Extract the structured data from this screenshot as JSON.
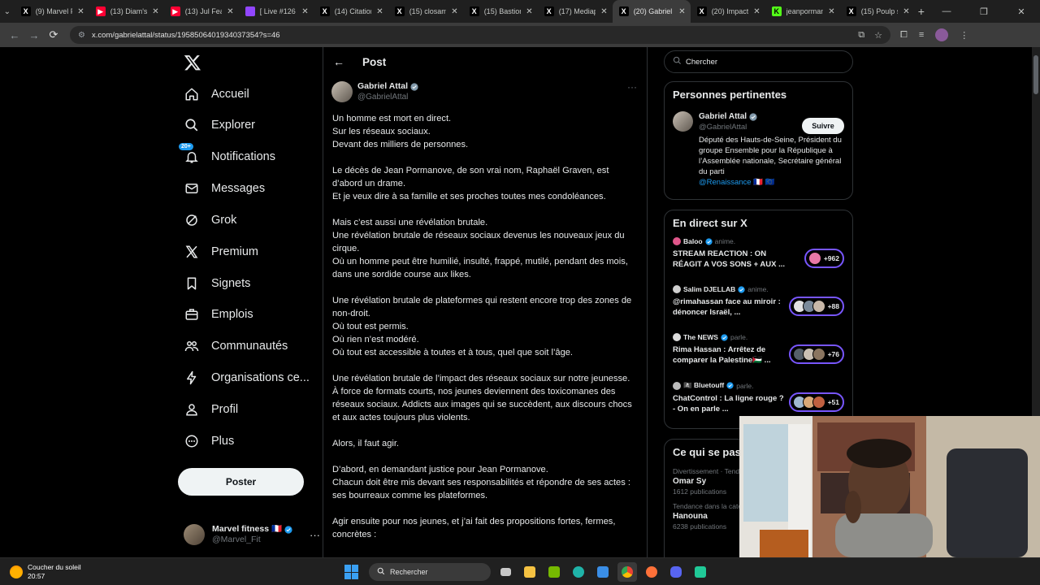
{
  "browser": {
    "tabs": [
      {
        "label": "(9) Marvel Fit",
        "fav_color": "#ffffff",
        "fav_text": "X",
        "fav_bg": "#000000"
      },
      {
        "label": "(13) Diam's,",
        "fav_color": "#ffffff",
        "fav_text": "▶",
        "fav_bg": "#ff0033"
      },
      {
        "label": "(13) Jul Feat",
        "fav_color": "#ffffff",
        "fav_text": "▶",
        "fav_bg": "#ff0033"
      },
      {
        "label": "[ Live #126 ]",
        "fav_color": "#ffffff",
        "fav_text": "",
        "fav_bg": "#9146ff"
      },
      {
        "label": "(14) Citation",
        "fav_color": "#ffffff",
        "fav_text": "X",
        "fav_bg": "#000000"
      },
      {
        "label": "(15) closam",
        "fav_color": "#ffffff",
        "fav_text": "X",
        "fav_bg": "#000000"
      },
      {
        "label": "(15) Bastion",
        "fav_color": "#ffffff",
        "fav_text": "X",
        "fav_bg": "#000000"
      },
      {
        "label": "(17) Mediap",
        "fav_color": "#ffffff",
        "fav_text": "X",
        "fav_bg": "#000000"
      },
      {
        "label": "(20) Gabriel",
        "fav_color": "#ffffff",
        "fav_text": "X",
        "fav_bg": "#000000",
        "active": true
      },
      {
        "label": "(20) Impact",
        "fav_color": "#ffffff",
        "fav_text": "X",
        "fav_bg": "#000000"
      },
      {
        "label": "jeanpormanc",
        "fav_color": "#000000",
        "fav_text": "K",
        "fav_bg": "#53fc18"
      },
      {
        "label": "(15) Poulp s",
        "fav_color": "#ffffff",
        "fav_text": "X",
        "fav_bg": "#000000"
      }
    ],
    "url": "x.com/gabrielattal/status/1958506401934037354?s=46"
  },
  "nav": {
    "items": [
      {
        "key": "home",
        "label": "Accueil"
      },
      {
        "key": "explore",
        "label": "Explorer"
      },
      {
        "key": "notifications",
        "label": "Notifications",
        "badge": "20+"
      },
      {
        "key": "messages",
        "label": "Messages"
      },
      {
        "key": "grok",
        "label": "Grok"
      },
      {
        "key": "premium",
        "label": "Premium"
      },
      {
        "key": "bookmarks",
        "label": "Signets"
      },
      {
        "key": "jobs",
        "label": "Emplois"
      },
      {
        "key": "communities",
        "label": "Communautés"
      },
      {
        "key": "orgs",
        "label": "Organisations ce..."
      },
      {
        "key": "profile",
        "label": "Profil"
      },
      {
        "key": "more",
        "label": "Plus"
      }
    ],
    "post_label": "Poster",
    "account": {
      "name": "Marvel fitness 🇫🇷",
      "handle": "@Marvel_Fit"
    }
  },
  "post": {
    "header_title": "Post",
    "author_name": "Gabriel Attal",
    "author_handle": "@GabrielAttal",
    "paragraphs": [
      [
        "Un homme est mort en direct.",
        "Sur les réseaux sociaux.",
        "Devant des milliers de personnes."
      ],
      [
        "Le décès de Jean Pormanove, de son vrai nom, Raphaël Graven, est d’abord un drame.",
        "Et je veux dire à sa famille et ses proches toutes mes condoléances."
      ],
      [
        "Mais c’est aussi une révélation brutale.",
        "Une révélation brutale de réseaux sociaux devenus les nouveaux jeux du cirque.",
        "Où un homme peut être humilié, insulté, frappé, mutilé, pendant des mois, dans une sordide course aux likes."
      ],
      [
        "Une révélation brutale de plateformes qui restent encore trop des zones de non-droit.",
        "Où tout est permis.",
        "Où rien n’est modéré.",
        "Où tout est accessible à toutes et à tous, quel que soit l’âge."
      ],
      [
        "Une révélation brutale de l’impact des réseaux sociaux sur notre jeunesse.",
        "À force de formats courts, nos jeunes deviennent des toxicomanes des réseaux sociaux. Addicts aux images qui se succèdent, aux discours chocs et aux actes toujours plus violents."
      ],
      [
        "Alors, il faut agir."
      ],
      [
        "D’abord, en demandant justice pour Jean Pormanove.",
        "Chacun doit être mis devant ses responsabilités et répondre de ses actes : ses bourreaux comme les plateformes."
      ],
      [
        "Agir ensuite pour nos jeunes, et j’ai fait des propositions fortes, fermes, concrètes :"
      ]
    ]
  },
  "sidebar": {
    "search_placeholder": "Chercher",
    "relevant": {
      "title": "Personnes pertinentes",
      "name": "Gabriel Attal",
      "handle": "@GabrielAttal",
      "follow_label": "Suivre",
      "bio": "Député des Hauts-de-Seine, Président du groupe Ensemble pour la République à l’Assemblée nationale, Secrétaire général du parti",
      "mention": "@Renaissance",
      "flags": "🇫🇷 🇪🇺"
    },
    "live": {
      "title": "En direct sur X",
      "items": [
        {
          "host": "Baloo",
          "activity": "anime.",
          "title": "STREAM REACTION : ON RÉAGIT A VOS SONS + AUX ...",
          "count": "+962",
          "host_color": "#e0568a",
          "dots": [
            "#e878a8"
          ]
        },
        {
          "host": "Salim DJELLAB",
          "activity": "anime.",
          "title": "@rimahassan face au miroir : dénoncer Israël, ...",
          "count": "+88",
          "host_color": "#cfcfcf",
          "dots": [
            "#e2e2e2",
            "#7a8a9a",
            "#c8b8a8"
          ]
        },
        {
          "host": "The NEWS",
          "activity": "parle.",
          "title": "Rima Hassan : Arrêtez de comparer la Palestine🇵🇸 ...",
          "count": "+76",
          "host_color": "#dddddd",
          "dots": [
            "#55606a",
            "#c9c0b4",
            "#8a7560"
          ]
        },
        {
          "host": "🏴‍☠️ Bluetouff",
          "activity": "parle.",
          "title": "ChatControl : La ligne rouge ? - On en parle ...",
          "count": "+51",
          "host_color": "#bbbbbb",
          "dots": [
            "#a0b8d0",
            "#d8a878",
            "#c06040"
          ]
        }
      ]
    },
    "trends": {
      "title": "Ce qui se passe",
      "items": [
        {
          "context": "Divertissement · Tendance",
          "name": "Omar Sy",
          "count": "1612 publications"
        },
        {
          "context": "Tendance dans la catégorie France",
          "name": "Hanouna",
          "count": "6238 publications"
        }
      ]
    }
  },
  "taskbar": {
    "weather_title": "Coucher du soleil",
    "time": "20:57",
    "search_label": "Rechercher"
  }
}
